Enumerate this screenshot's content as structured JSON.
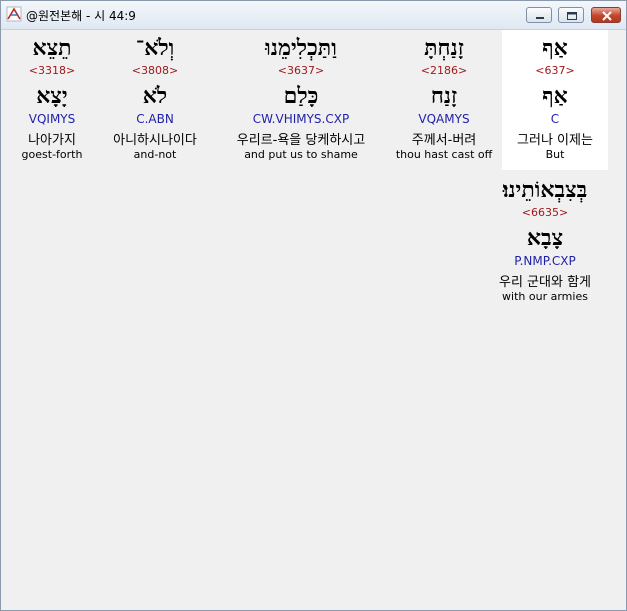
{
  "window": {
    "title": "@원전본해 - 시 44:9"
  },
  "words": [
    {
      "hebrew": "אַף",
      "strong": "<637>",
      "lemma": "אַף",
      "morph": "C",
      "korean": "그러나 이제는",
      "english": "But",
      "selected": true
    },
    {
      "hebrew": "זָנַחְתָּ",
      "strong": "<2186>",
      "lemma": "זָנַח",
      "morph": "VQAMYS",
      "korean": "주께서-버려",
      "english": "thou hast cast off",
      "selected": false
    },
    {
      "hebrew": "וַתַּכְלִימֵנוּ",
      "strong": "<3637>",
      "lemma": "כָּלַם",
      "morph": "CW.VHIMYS.CXP",
      "korean": "우리르-욕을 당케하시고",
      "english": "and put us to shame",
      "selected": false
    },
    {
      "hebrew": "וְלֹא־",
      "strong": "<3808>",
      "lemma": "לֹא",
      "morph": "C.ABN",
      "korean": "아니하시나이다",
      "english": "and-not",
      "selected": false
    },
    {
      "hebrew": "תֵצֵא",
      "strong": "<3318>",
      "lemma": "יָצָא",
      "morph": "VQIMYS",
      "korean": "나아가지",
      "english": "goest-forth",
      "selected": false
    },
    {
      "hebrew": "בְּצִבְאוֹתֵינוּ׃",
      "strong": "<6635>",
      "lemma": "צָבָא",
      "morph": "P.NMP.CXP",
      "korean": "우리 군대와 함게",
      "english": "with our armies",
      "selected": false
    }
  ]
}
